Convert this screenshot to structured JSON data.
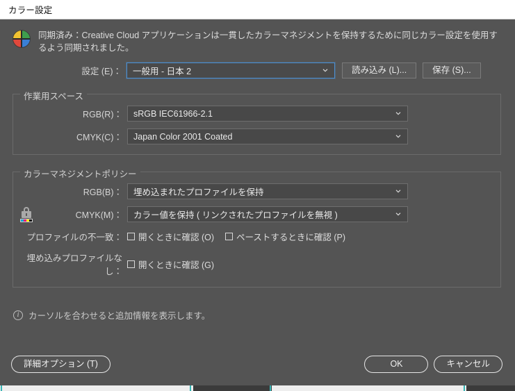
{
  "window": {
    "title": "カラー設定"
  },
  "sync": {
    "icon": "creative-cloud-sync-icon",
    "message": "同期済み：Creative Cloud アプリケーションは一貫したカラーマネジメントを保持するために同じカラー設定を使用するよう同期されました。"
  },
  "settings": {
    "label": "設定 (E)：",
    "value": "一般用 - 日本 2",
    "import_label": "読み込み (L)...",
    "save_label": "保存 (S)..."
  },
  "working_spaces": {
    "title": "作業用スペース",
    "rows": [
      {
        "label": "RGB(R)：",
        "value": "sRGB IEC61966-2.1"
      },
      {
        "label": "CMYK(C)：",
        "value": "Japan Color 2001 Coated"
      }
    ]
  },
  "policies": {
    "title": "カラーマネジメントポリシー",
    "rows": [
      {
        "label": "RGB(B)：",
        "value": "埋め込まれたプロファイルを保持"
      },
      {
        "label": "CMYK(M)：",
        "value": "カラー値を保持 ( リンクされたプロファイルを無視 )"
      }
    ]
  },
  "checkboxes": {
    "mismatch_label": "プロファイルの不一致：",
    "mismatch_items": [
      {
        "label": "開くときに確認 (O)",
        "checked": false
      },
      {
        "label": "ペーストするときに確認 (P)",
        "checked": false
      }
    ],
    "missing_label": "埋め込みプロファイルなし：",
    "missing_items": [
      {
        "label": "開くときに確認 (G)",
        "checked": false
      }
    ]
  },
  "info": {
    "icon": "info-circle-icon",
    "text": "カーソルを合わせると追加情報を表示します。"
  },
  "footer": {
    "advanced_label": "詳細オプション (T)",
    "ok_label": "OK",
    "cancel_label": "キャンセル"
  },
  "colors": {
    "dialog_bg": "#545454",
    "titlebar_bg": "#ffffff",
    "focus_border": "#4c8ed0",
    "text": "#dcdcdc",
    "control_bg": "#484848",
    "button_bg": "#5a5a5a"
  }
}
